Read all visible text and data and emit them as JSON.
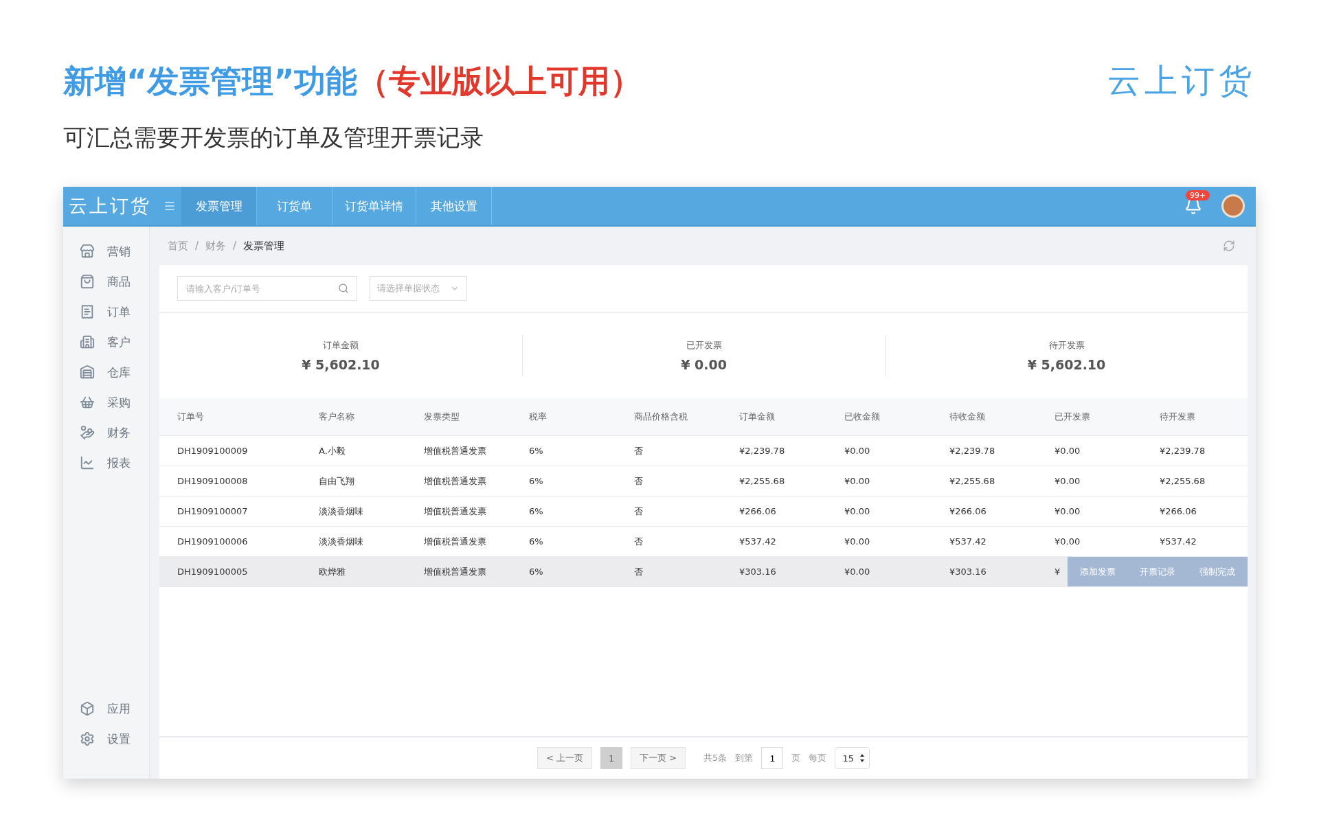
{
  "headline": {
    "main": "新增“发票管理”功能",
    "note": "（专业版以上可用）"
  },
  "subtitle": "可汇总需要开发票的订单及管理开票记录",
  "brand_logo": "云上订货",
  "app": {
    "logo": "云上订货",
    "tabs": [
      {
        "label": "发票管理",
        "selected": true
      },
      {
        "label": "订货单",
        "selected": false
      },
      {
        "label": "订货单详情",
        "selected": false
      },
      {
        "label": "其他设置",
        "selected": false
      }
    ],
    "notification_badge": "99+",
    "sidebar": {
      "items": [
        "营销",
        "商品",
        "订单",
        "客户",
        "仓库",
        "采购",
        "财务",
        "报表"
      ],
      "bottom_items": [
        "应用",
        "设置"
      ]
    },
    "breadcrumb": [
      {
        "label": "首页"
      },
      {
        "separator": "/",
        "label": "财务"
      },
      {
        "separator": "/",
        "label": "发票管理"
      }
    ],
    "search": {
      "placeholder": "请输入客户/订单号"
    },
    "status_filter": {
      "placeholder": "请选择单据状态"
    },
    "summary": [
      {
        "label": "订单金额",
        "value": "¥ 5,602.10"
      },
      {
        "label": "已开发票",
        "value": "¥ 0.00"
      },
      {
        "label": "待开发票",
        "value": "¥ 5,602.10"
      }
    ],
    "table": {
      "columns": [
        "订单号",
        "客户名称",
        "发票类型",
        "税率",
        "商品价格含税",
        "订单金额",
        "已收金额",
        "待收金额",
        "已开发票",
        "待开发票"
      ],
      "rows": [
        {
          "highlighted": false,
          "cells": [
            "DH1909100009",
            "A.小毅",
            "增值税普通发票",
            "6%",
            "否",
            "¥2,239.78",
            "¥0.00",
            "¥2,239.78",
            "¥0.00",
            "¥2,239.78"
          ]
        },
        {
          "highlighted": false,
          "cells": [
            "DH1909100008",
            "自由飞翔",
            "增值税普通发票",
            "6%",
            "否",
            "¥2,255.68",
            "¥0.00",
            "¥2,255.68",
            "¥0.00",
            "¥2,255.68"
          ]
        },
        {
          "highlighted": false,
          "cells": [
            "DH1909100007",
            "淡淡香烟味",
            "增值税普通发票",
            "6%",
            "否",
            "¥266.06",
            "¥0.00",
            "¥266.06",
            "¥0.00",
            "¥266.06"
          ]
        },
        {
          "highlighted": false,
          "cells": [
            "DH1909100006",
            "淡淡香烟味",
            "增值税普通发票",
            "6%",
            "否",
            "¥537.42",
            "¥0.00",
            "¥537.42",
            "¥0.00",
            "¥537.42"
          ]
        },
        {
          "highlighted": true,
          "cells": [
            "DH1909100005",
            "欧烨雅",
            "增值税普通发票",
            "6%",
            "否",
            "¥303.16",
            "¥0.00",
            "¥303.16",
            "¥"
          ],
          "actions": [
            "添加发票",
            "开票记录",
            "强制完成"
          ]
        }
      ]
    },
    "pagination": {
      "prev": "< 上一页",
      "pages": [
        {
          "label": "1",
          "selected": true
        }
      ],
      "next": "下一页 >",
      "total": "共5条",
      "goto_label": "到第",
      "goto_value": "1",
      "page_unit": "页",
      "per_page_label": "每页",
      "per_page": "15"
    }
  }
}
